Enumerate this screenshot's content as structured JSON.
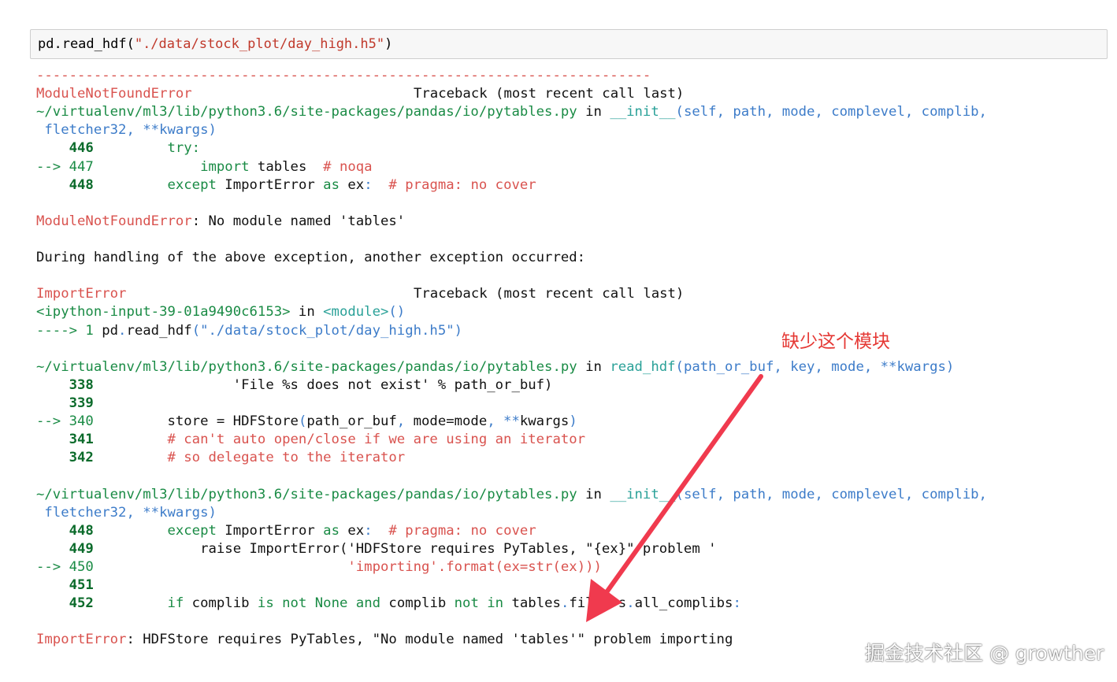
{
  "input": {
    "pre": "pd.read_hdf(",
    "arg": "\"./data/stock_plot/day_high.h5\"",
    "post": ")"
  },
  "colors": {
    "error_red": "#d9534f",
    "line_green": "#1a8b45",
    "cyan": "#2aa198",
    "blue": "#3d7cc9",
    "arrow_red": "#f03a4e"
  },
  "lines": {
    "l01": "---------------------------------------------------------------------------",
    "l02a": "ModuleNotFoundError",
    "l02b": "Traceback (most recent call last)",
    "l03a": "~/virtualenv/ml3/lib/python3.6/site-packages/pandas/io/pytables.py",
    "l03b": " in ",
    "l03c": "__init__",
    "l03d": "(self, path, mode, complevel, complib,",
    "l04": " fletcher32, **kwargs)",
    "l05a": "    446 ",
    "l05b": "        try:",
    "l06a": "--> 447 ",
    "l06b": "            import",
    "l06c": " tables  ",
    "l06d": "# noqa",
    "l07a": "    448 ",
    "l07b": "        except",
    "l07c": " ImportError ",
    "l07d": "as",
    "l07e": " ex",
    "l07f": ":",
    "l07g": "  # pragma: no cover",
    "l09a": "ModuleNotFoundError",
    "l09b": ": No module named 'tables'",
    "l11": "During handling of the above exception, another exception occurred:",
    "l13a": "ImportError",
    "l13b": "Traceback (most recent call last)",
    "l14a": "<ipython-input-39-01a9490c6153>",
    "l14b": " in ",
    "l14c": "<module>",
    "l14d": "()",
    "l15a": "----> 1 ",
    "l15b": "pd",
    "l15c": ".",
    "l15d": "read_hdf",
    "l15e": "(",
    "l15f": "\"./data/stock_plot/day_high.h5\"",
    "l15g": ")",
    "l17a": "~/virtualenv/ml3/lib/python3.6/site-packages/pandas/io/pytables.py",
    "l17b": " in ",
    "l17c": "read_hdf",
    "l17d": "(path_or_buf, key, mode, **kwargs)",
    "l18a": "    338 ",
    "l18b": "                'File %s does not exist' % path_or_buf)",
    "l19a": "    339 ",
    "l20a": "--> 340 ",
    "l20b": "        store = HDFStore",
    "l20c": "(",
    "l20d": "path_or_buf",
    "l20e": ",",
    "l20f": " mode=mode",
    "l20g": ",",
    "l20h": " **",
    "l20i": "kwargs",
    "l20j": ")",
    "l21a": "    341 ",
    "l21b": "        # can't auto open/close if we are using an iterator",
    "l22a": "    342 ",
    "l22b": "        # so delegate to the iterator",
    "l24a": "~/virtualenv/ml3/lib/python3.6/site-packages/pandas/io/pytables.py",
    "l24b": " in ",
    "l24c": "__init__",
    "l24d": "(self, path, mode, complevel, complib,",
    "l25": " fletcher32, **kwargs)",
    "l26a": "    448 ",
    "l26b": "        except",
    "l26c": " ImportError ",
    "l26d": "as",
    "l26e": " ex",
    "l26f": ":",
    "l26g": "  # pragma: no cover",
    "l27a": "    449 ",
    "l27b": "            raise ImportError('HDFStore requires PyTables, \"{ex}\" problem '",
    "l28a": "--> 450 ",
    "l28b": "                              ",
    "l28c": "'importing'",
    "l28d": ".format(ex=str(ex)))",
    "l29a": "    451 ",
    "l30a": "    452 ",
    "l30b": "        ",
    "l30c": "if",
    "l30d": " complib ",
    "l30e": "is",
    "l30f": " ",
    "l30g": "not",
    "l30h": " ",
    "l30i": "None",
    "l30j": " ",
    "l30k": "and",
    "l30l": " complib ",
    "l30m": "not",
    "l30n": " ",
    "l30o": "in",
    "l30p": " tables",
    "l30q": ".",
    "l30r": "filters",
    "l30s": ".",
    "l30t": "all_complibs",
    "l30u": ":",
    "l32a": "ImportError",
    "l32b": ": HDFStore requires PyTables, \"No module named 'tables'\" problem importing"
  },
  "annotation": "缺少这个模块",
  "watermark": "掘金技术社区 @ growther"
}
